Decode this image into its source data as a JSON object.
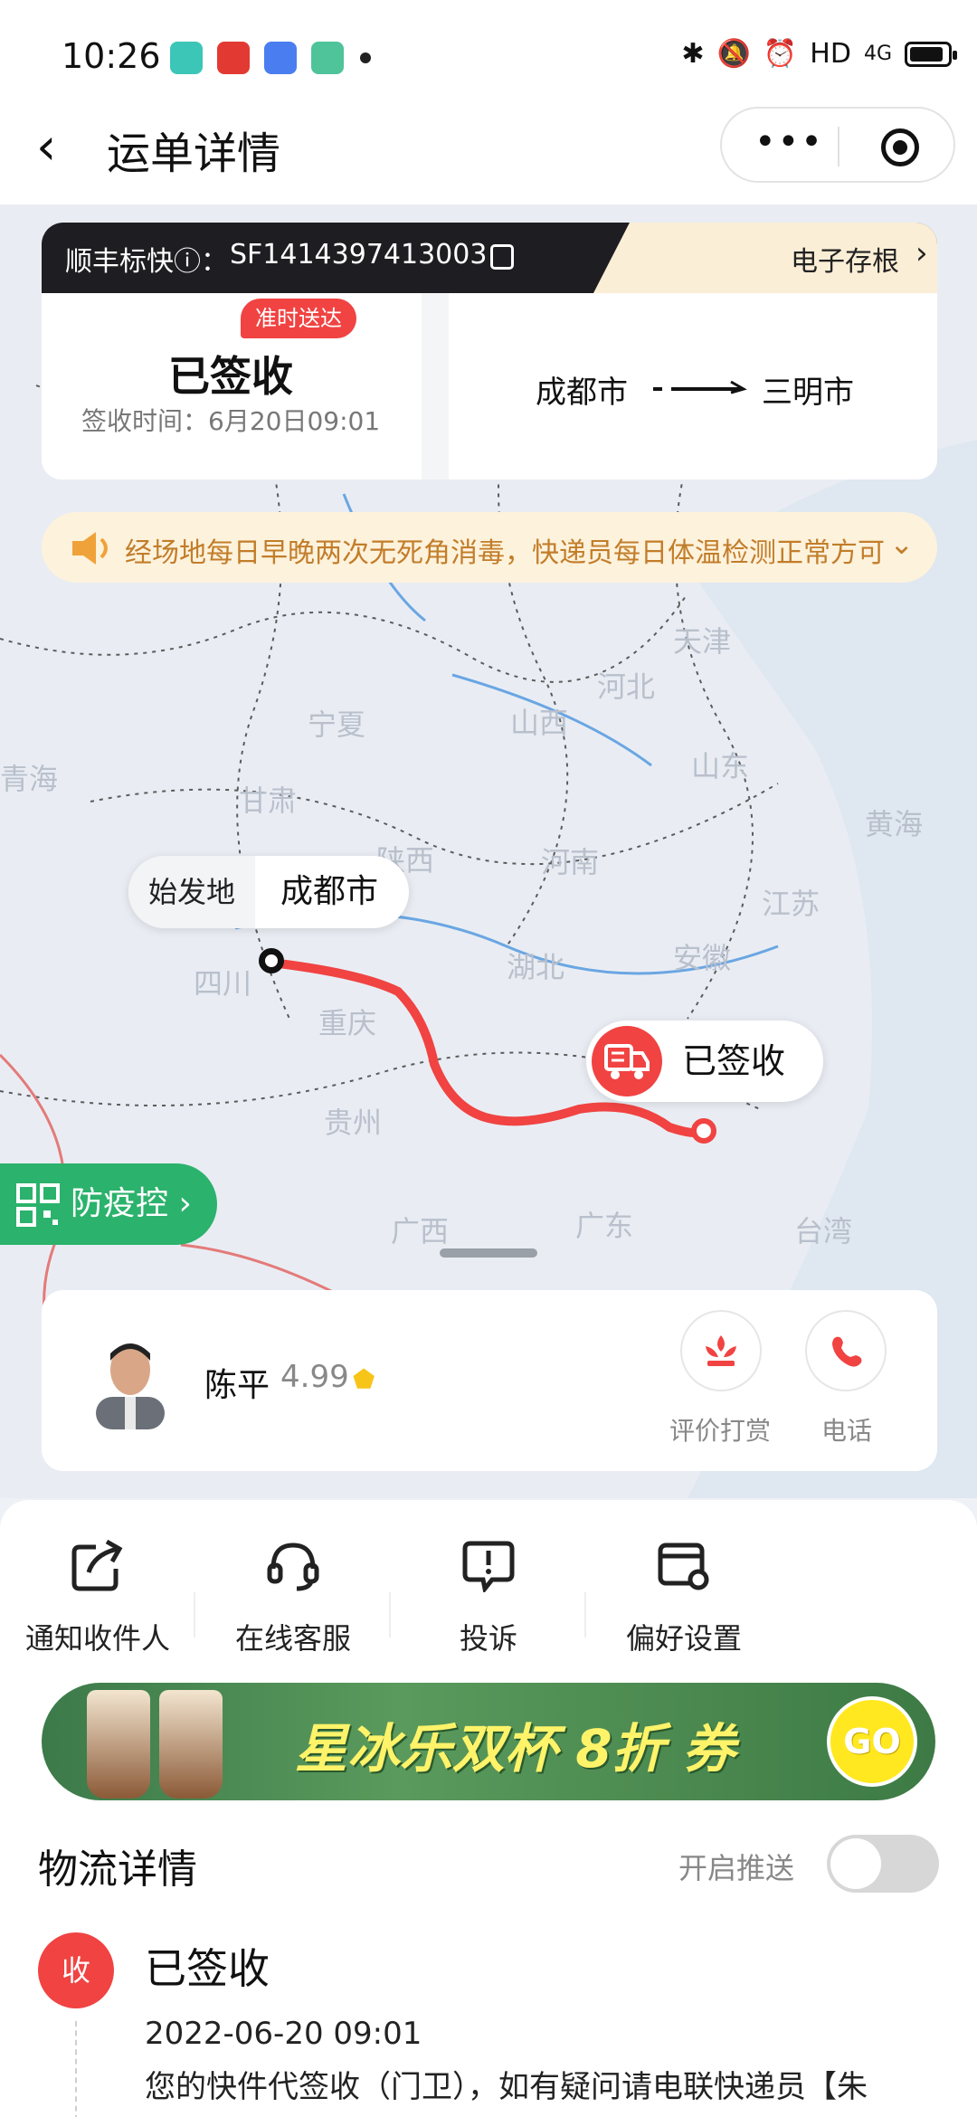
{
  "status_bar": {
    "time": "10:26",
    "network": "HD",
    "signal": "4G"
  },
  "nav": {
    "back_icon": "back-arrow-icon",
    "title": "运单详情",
    "more_icon": "more-dots-icon",
    "target_icon": "target-icon"
  },
  "waybill": {
    "carrier_label": "顺丰标快ⓘ：",
    "tracking_number": "SF1414397413003",
    "stub_label": "电子存根",
    "ontime_badge": "准时送达",
    "status": "已签收",
    "signed_time": "签收时间：6月20日09:01",
    "from_city": "成都市",
    "to_city": "三明市"
  },
  "notice": {
    "text": "经场地每日早晚两次无死角消毒，快递员每日体温检测正常方可"
  },
  "map": {
    "provinces": [
      "宁夏",
      "甘肃",
      "青海",
      "山西",
      "河北",
      "天津",
      "山东",
      "黄海",
      "陕西",
      "河南",
      "江苏",
      "四川",
      "湖北",
      "安徽",
      "重庆",
      "贵州",
      "广西",
      "广东",
      "台湾"
    ],
    "origin_tag": "始发地",
    "origin_city": "成都市",
    "dest_status": "已签收",
    "route_color": "#f04342"
  },
  "epidemic_button": {
    "label": "防疫控",
    "color": "#2bb26c"
  },
  "courier": {
    "name": "陈平",
    "rating": "4.99",
    "rate_label": "评价打赏",
    "phone_label": "电话"
  },
  "quick_actions": [
    {
      "label": "通知收件人",
      "icon": "share-icon"
    },
    {
      "label": "在线客服",
      "icon": "headset-icon"
    },
    {
      "label": "投诉",
      "icon": "complaint-icon"
    },
    {
      "label": "偏好设置",
      "icon": "settings-card-icon"
    }
  ],
  "banner": {
    "text": "星冰乐双杯 8折 券",
    "go": "GO"
  },
  "logistics": {
    "title": "物流详情",
    "push_label": "开启推送",
    "push_enabled": false,
    "event_badge": "收",
    "event_status": "已签收",
    "event_time": "2022-06-20 09:01",
    "event_desc": "您的快件代签收（门卫），如有疑问请电联快递员【朱"
  },
  "colors": {
    "accent_red": "#f04342",
    "notice_text": "#c27d2a",
    "notice_bg": "#fdf2dc",
    "dark_header": "#1e1e22"
  }
}
